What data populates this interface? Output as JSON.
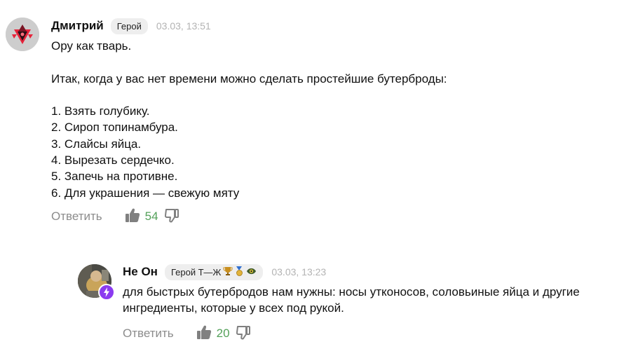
{
  "comments": [
    {
      "author": "Дмитрий",
      "badge": "Герой",
      "time": "03.03, 13:51",
      "lines": [
        "Ору как тварь.",
        "",
        "Итак, когда у вас нет времени можно сделать простейшие бутерброды:",
        "",
        "1. Взять голубику.",
        "2. Сироп топинамбура.",
        "3. Слайсы яйца.",
        "4. Вырезать сердечко.",
        "5. Запечь на противне.",
        "6. Для украшения — свежую мяту"
      ],
      "reply_label": "Ответить",
      "likes": "54"
    },
    {
      "author": "Не Он",
      "badge": "Герой Т—Ж",
      "badge_icons": [
        "trophy-icon",
        "medal-icon",
        "eye-icon"
      ],
      "time": "03.03, 13:23",
      "lines": [
        "для быстрых бутербродов нам нужны: носы утконосов, соловьиные яйца и другие",
        "ингредиенты, которые у всех под рукой."
      ],
      "reply_label": "Ответить",
      "likes": "20"
    }
  ],
  "colors": {
    "like_count": "#54a15a",
    "muted": "#8c8c8c",
    "time": "#b3b3b3",
    "badge_bg": "#eeeeee",
    "avatar_accent": "#e6233a",
    "status_badge": "#8b3bf0"
  }
}
